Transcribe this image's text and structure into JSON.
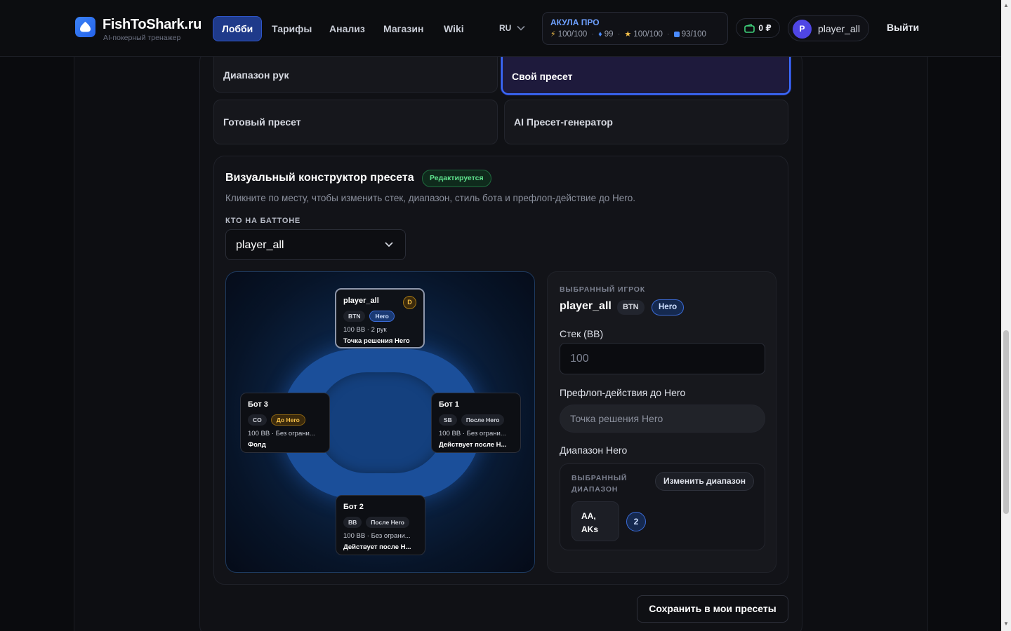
{
  "header": {
    "logo_title": "FishToShark.ru",
    "logo_subtitle": "AI-покерный тренажер",
    "nav": [
      {
        "label": "Лобби",
        "active": true
      },
      {
        "label": "Тарифы",
        "active": false
      },
      {
        "label": "Анализ",
        "active": false
      },
      {
        "label": "Магазин",
        "active": false
      },
      {
        "label": "Wiki",
        "active": false
      }
    ],
    "language": "RU",
    "plan": {
      "title": "АКУЛА ПРО",
      "energy": "100/100",
      "gems": "99",
      "stars": "100/100",
      "tokens": "93/100"
    },
    "balance": "0 ₽",
    "user": {
      "initial": "P",
      "name": "player_all"
    },
    "logout": "Выйти"
  },
  "options": {
    "range": "Диапазон рук",
    "custom": "Свой пресет",
    "ready": "Готовый пресет",
    "ai": "AI Пресет-генератор",
    "selected": "custom"
  },
  "builder": {
    "title": "Визуальный конструктор пресета",
    "badge": "Редактируется",
    "description": "Кликните по месту, чтобы изменить стек, диапазон, стиль бота и префлоп-действие до Hero.",
    "button_label": "КТО НА БАТТОНЕ",
    "button_value": "player_all"
  },
  "seats": {
    "top": {
      "name": "player_all",
      "pos": "BTN",
      "tag": "Hero",
      "line1": "100 BB · 2 рук",
      "line2": "Точка решения Hero",
      "dealer": "D"
    },
    "left": {
      "name": "Бот 3",
      "pos": "CO",
      "tag": "До Hero",
      "line1": "100 BB · Без ограни...",
      "line2": "Фолд"
    },
    "right": {
      "name": "Бот 1",
      "pos": "SB",
      "tag": "После Hero",
      "line1": "100 BB · Без ограни...",
      "line2": "Действует после Н..."
    },
    "bottom": {
      "name": "Бот 2",
      "pos": "BB",
      "tag": "После Hero",
      "line1": "100 BB · Без ограни...",
      "line2": "Действует после Н..."
    }
  },
  "panel": {
    "label": "ВЫБРАННЫЙ ИГРОК",
    "name": "player_all",
    "pos": "BTN",
    "hero": "Hero",
    "stack_label": "Стек (BB)",
    "stack_value": "100",
    "actions_label": "Префлоп-действия до Hero",
    "actions_value": "Точка решения Hero",
    "range_label": "Диапазон Hero",
    "range_sublabel": "ВЫБРАННЫЙ ДИАПАЗОН",
    "range_button": "Изменить диапазон",
    "range_chip": "AA, AKs",
    "range_count": "2"
  },
  "save_button": "Сохранить в мои пресеты",
  "colors": {
    "accent": "#3b6bff",
    "success": "#5ee08c",
    "warning": "#f5c04a"
  }
}
